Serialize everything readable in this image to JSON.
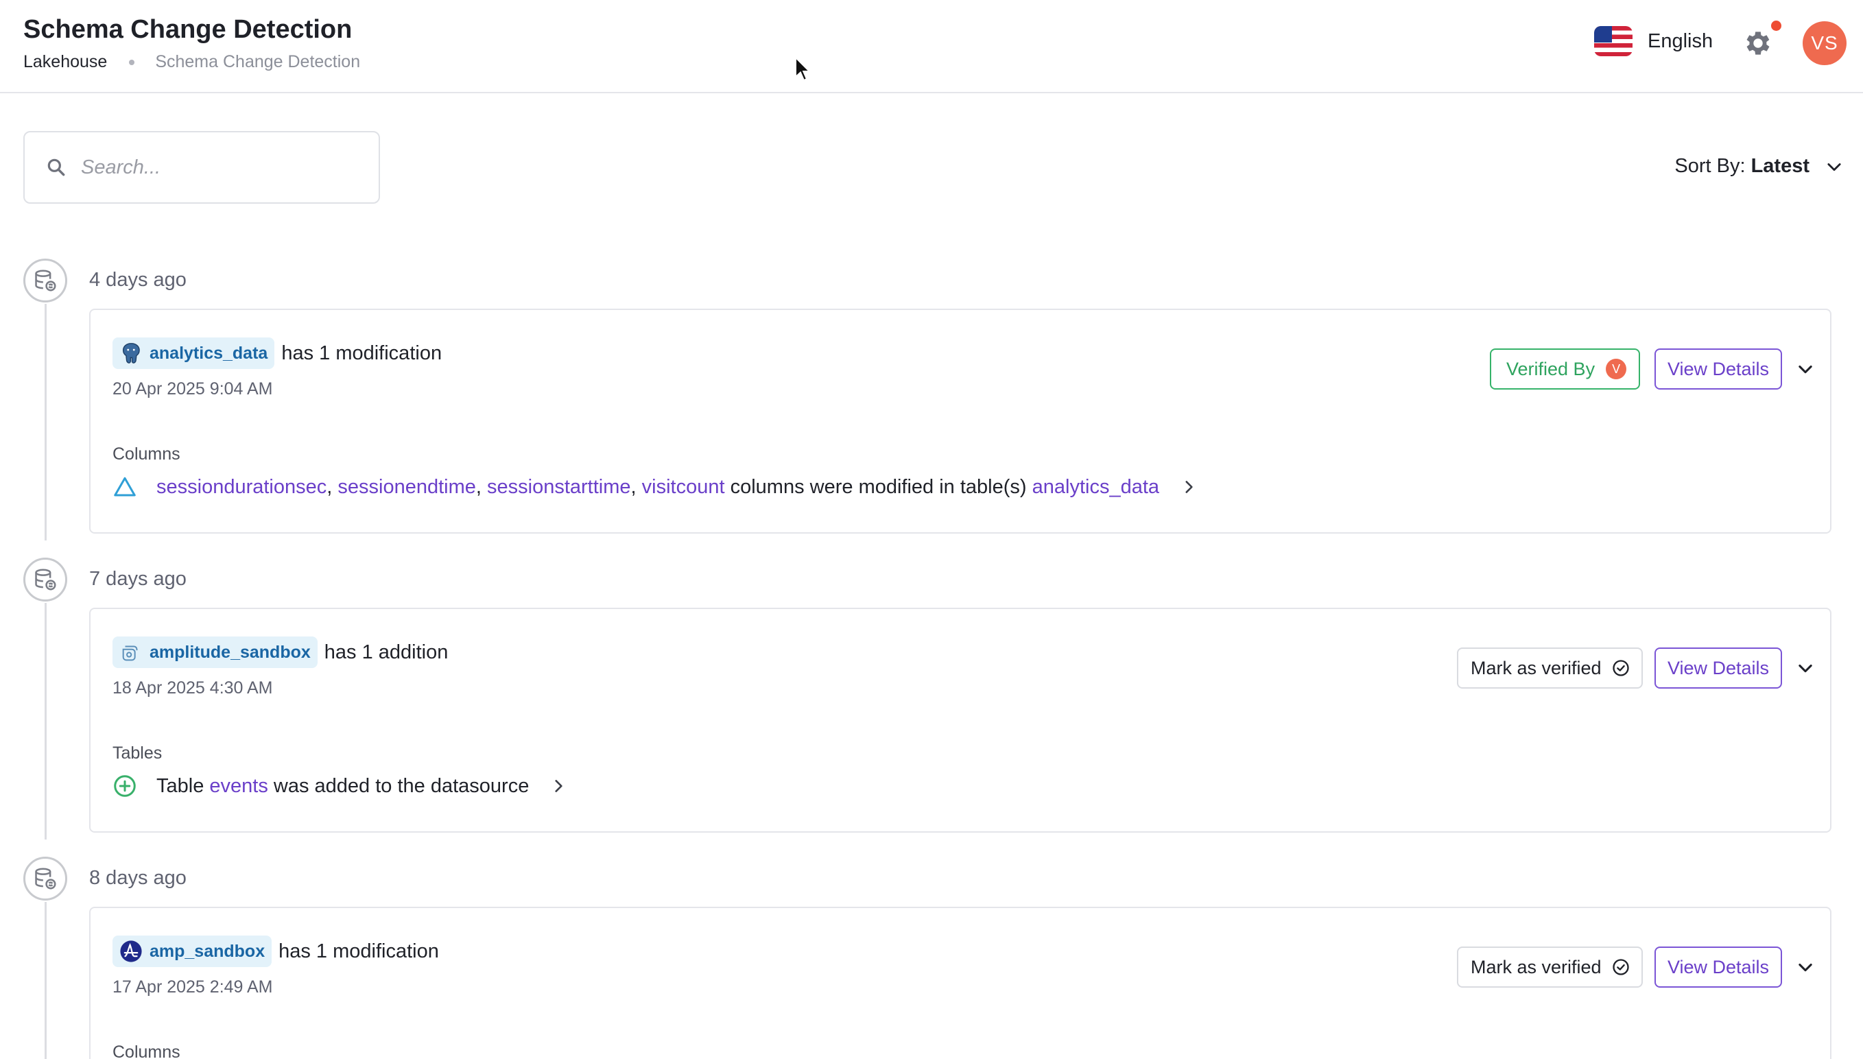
{
  "header": {
    "title": "Schema Change Detection",
    "breadcrumb": {
      "root": "Lakehouse",
      "current": "Schema Change Detection"
    },
    "language": "English",
    "avatar_initials": "VS",
    "colors": {
      "accent": "#6a3fc9",
      "avatar": "#ef6a4f",
      "notification": "#ee4d33"
    }
  },
  "toolbar": {
    "search_placeholder": "Search...",
    "sort_label": "Sort By:",
    "sort_value": "Latest"
  },
  "events": [
    {
      "age": "4 days ago",
      "source": {
        "name": "analytics_data",
        "icon": "postgres-elephant-icon"
      },
      "summary": "has 1 modification",
      "timestamp": "20 Apr 2025 9:04 AM",
      "status": {
        "type": "verified",
        "label": "Verified By",
        "verifier_initial": "V"
      },
      "view_label": "View Details",
      "section": "Columns",
      "change": {
        "icon": "modified-triangle-icon",
        "items": [
          "sessiondurationsec",
          "sessionendtime",
          "sessionstarttime",
          "visitcount"
        ],
        "sep": ", ",
        "text": "columns were modified in table(s)",
        "target": "analytics_data"
      }
    },
    {
      "age": "7 days ago",
      "source": {
        "name": "amplitude_sandbox",
        "icon": "amplitude-sandbox-icon"
      },
      "summary": "has 1 addition",
      "timestamp": "18 Apr 2025 4:30 AM",
      "status": {
        "type": "unverified",
        "label": "Mark as verified"
      },
      "view_label": "View Details",
      "section": "Tables",
      "change": {
        "icon": "added-plus-circle-icon",
        "prefix": "Table",
        "item": "events",
        "text": "was added to the datasource"
      }
    },
    {
      "age": "8 days ago",
      "source": {
        "name": "amp_sandbox",
        "icon": "amplitude-logo-icon"
      },
      "summary": "has 1 modification",
      "timestamp": "17 Apr 2025 2:49 AM",
      "status": {
        "type": "unverified",
        "label": "Mark as verified"
      },
      "view_label": "View Details",
      "section": "Columns"
    }
  ]
}
